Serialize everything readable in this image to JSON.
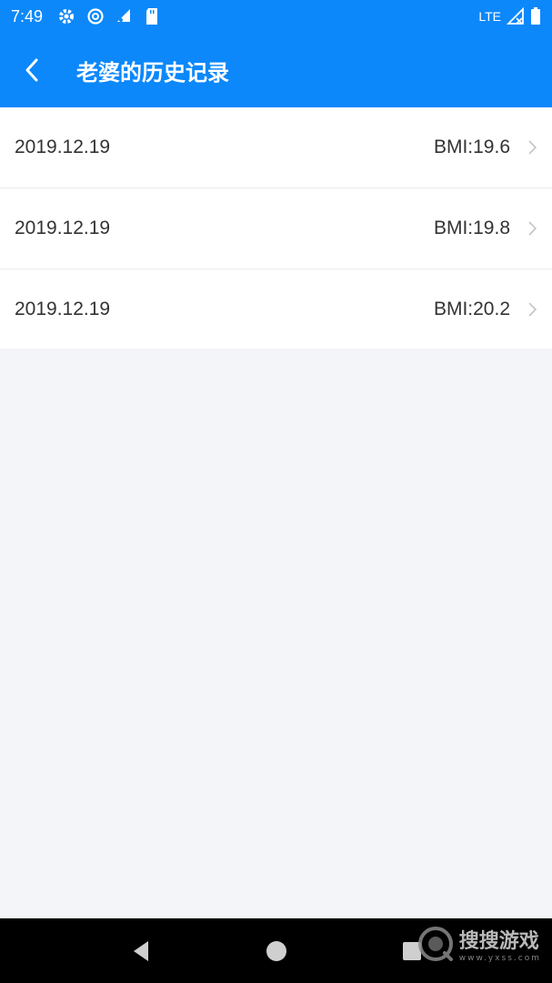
{
  "status_bar": {
    "time": "7:49",
    "network": "LTE",
    "icons_left": [
      "settings-icon",
      "data-saver-icon",
      "wifi-off-icon",
      "sd-card-icon"
    ],
    "icons_right": [
      "signal-icon",
      "battery-icon"
    ]
  },
  "toolbar": {
    "title": "老婆的历史记录",
    "back_icon": "back-arrow-icon",
    "background": "#0c88fb"
  },
  "records": [
    {
      "date": "2019.12.19",
      "bmi": "BMI:19.6"
    },
    {
      "date": "2019.12.19",
      "bmi": "BMI:19.8"
    },
    {
      "date": "2019.12.19",
      "bmi": "BMI:20.2"
    }
  ],
  "nav_bar": {
    "buttons": [
      "back-triangle-icon",
      "home-circle-icon",
      "recents-square-icon"
    ]
  },
  "watermark": {
    "text": "搜搜游戏",
    "sub": "www.yxss.com"
  }
}
